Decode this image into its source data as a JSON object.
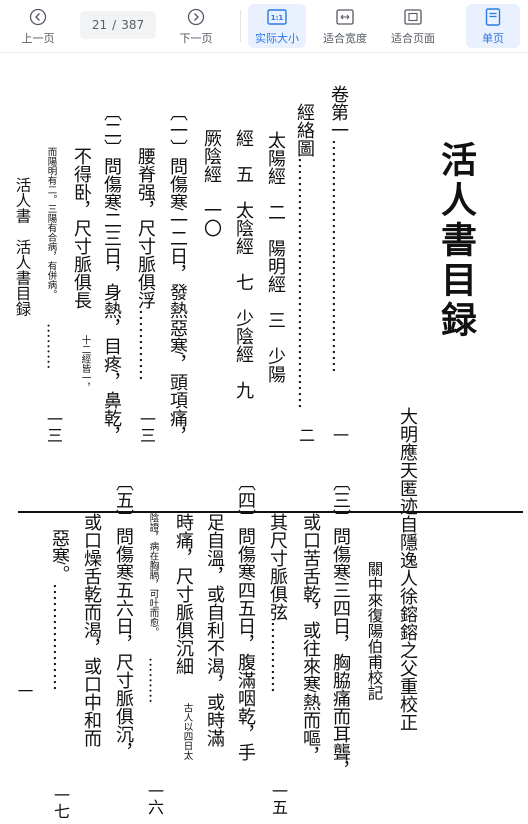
{
  "toolbar": {
    "prev": {
      "label": "上一页",
      "icon": "chevron-left-circle-icon"
    },
    "page_current": "21",
    "page_sep": "/",
    "page_total": "387",
    "next": {
      "label": "下一页",
      "icon": "chevron-right-circle-icon"
    },
    "actual_size": {
      "label": "实际大小",
      "icon": "actual-size-icon",
      "badge": "1:1",
      "active": true
    },
    "fit_width": {
      "label": "适合宽度",
      "icon": "fit-width-icon"
    },
    "fit_page": {
      "label": "适合页面",
      "icon": "fit-page-icon"
    },
    "single_page": {
      "label": "单页",
      "icon": "single-page-icon",
      "active": true
    },
    "accent_color": "#2a7ae4"
  },
  "document": {
    "title": "活人書目録",
    "author_line": "大明應天匿迹自隱逸人徐鎔鎔之父重校正",
    "editor_line": "關中來復陽伯甫校記",
    "upper": {
      "c1": "卷第一…………………………………",
      "c1_page": "一",
      "c2": "經絡圖……………………………………",
      "c2_page": "二",
      "c3": "太陽經　二　陽明經　三　少陽",
      "c4": "經　五　太陰經　七　少陰經　九",
      "c5": "厥陰經　一〇",
      "c6": "〔一〕問傷寒一二日，發熱惡寒，頭項痛，",
      "c7": "腰脊强，尺寸脈俱浮…………",
      "c7_page": "一三",
      "c8": "〔二〕問傷寒二三日，身熱，目疼，鼻乾，",
      "c9": "不得卧，尺寸脈俱長",
      "c9_note": "十二經皆一，",
      "c10": "而陽明有二。三陽有合病，有併病。",
      "c10_dots": "………",
      "c10_page": "一三",
      "c11": "活人書　活人書目録"
    },
    "lower": {
      "c1": "〔三〕問傷寒三四日，胸脇痛而耳聾，",
      "c2": "或口苦舌乾，或往來寒熱而嘔，",
      "c3": "其尺寸脈俱弦…………",
      "c3_page": "一五",
      "c4": "〔四〕問傷寒四五日，腹滿咽乾，手",
      "c5": "足自溫，或自利不渴，或時滿",
      "c6": "時痛，尺寸脈俱沉細",
      "c6_note": "古人以四日太",
      "c7": "陰證，病在胸膈，可吐而愈。",
      "c7_dots": "………",
      "c7_page": "一六",
      "c8": "〔五〕問傷寒五六日，尺寸脈俱沉，",
      "c9": "或口燥舌乾而渴，或口中和而",
      "c10": "惡寒。………………",
      "c10_page": "一七",
      "folio": "一"
    }
  }
}
